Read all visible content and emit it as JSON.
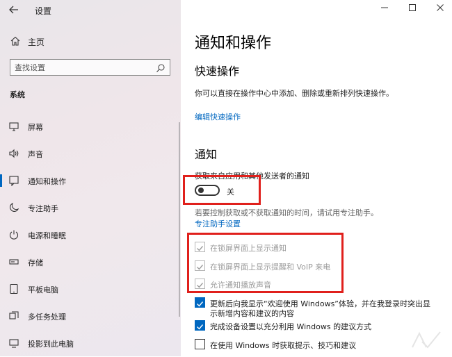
{
  "window": {
    "title": "设置"
  },
  "sidebar": {
    "home": "主页",
    "search_placeholder": "查找设置",
    "section": "系统",
    "items": [
      {
        "label": "屏幕",
        "icon": "monitor-icon"
      },
      {
        "label": "声音",
        "icon": "speaker-icon"
      },
      {
        "label": "通知和操作",
        "icon": "notification-icon",
        "active": true
      },
      {
        "label": "专注助手",
        "icon": "moon-icon"
      },
      {
        "label": "电源和睡眠",
        "icon": "power-icon"
      },
      {
        "label": "存储",
        "icon": "storage-icon"
      },
      {
        "label": "平板电脑",
        "icon": "tablet-icon"
      },
      {
        "label": "多任务处理",
        "icon": "multitask-icon"
      },
      {
        "label": "投影到此电脑",
        "icon": "project-icon"
      }
    ]
  },
  "main": {
    "title": "通知和操作",
    "quick_actions": {
      "heading": "快速操作",
      "desc": "你可以直接在操作中心中添加、删除或重新排列快速操作。",
      "edit_link": "编辑快速操作"
    },
    "notifications": {
      "heading": "通知",
      "get_label": "获取来自应用和其他发送者的通知",
      "toggle_state": "关",
      "toggle_on": false,
      "hint": "若要控制获取或不获取通知的时间，请试用专注助手。",
      "focus_link": "专注助手设置",
      "checkboxes": [
        {
          "label": "在锁屏界面上显示通知",
          "checked": true,
          "disabled": true
        },
        {
          "label": "在锁屏界面上显示提醒和 VoIP 来电",
          "checked": true,
          "disabled": true
        },
        {
          "label": "允许通知播放声音",
          "checked": true,
          "disabled": true
        },
        {
          "label_line1": "更新后向我显示“欢迎使用 Windows”体验，并在我登录时突出显",
          "label_line2": "示新增内容和建议的内容",
          "checked": true,
          "disabled": false
        },
        {
          "label": "完成设备设置以充分利用 Windows 的建议方式",
          "checked": true,
          "disabled": false
        },
        {
          "label": "在使用 Windows 时获取提示、技巧和建议",
          "checked": false,
          "disabled": false
        }
      ]
    }
  },
  "colors": {
    "accent": "#0067c0",
    "highlight": "#e0201c"
  }
}
